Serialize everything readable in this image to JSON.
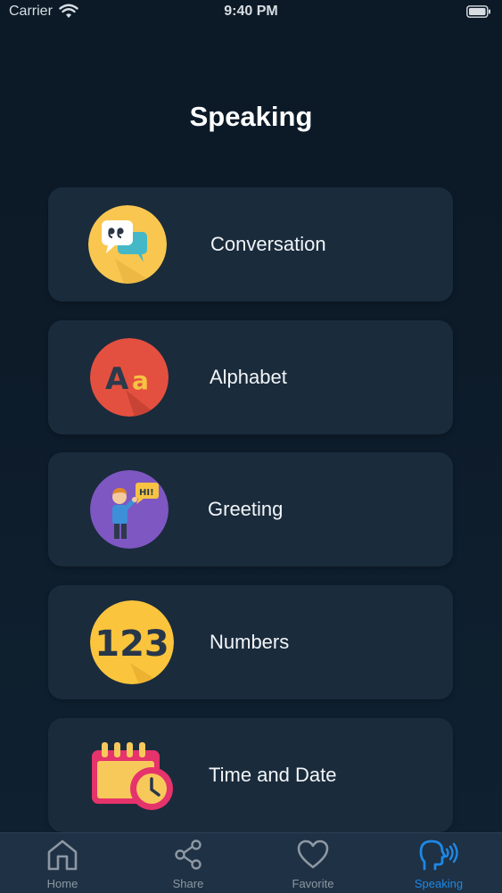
{
  "status_bar": {
    "carrier": "Carrier",
    "time": "9:40 PM"
  },
  "title": "Speaking",
  "categories": [
    {
      "label": "Conversation",
      "icon": "speech-bubbles-icon",
      "color": "#f9c74f"
    },
    {
      "label": "Alphabet",
      "icon": "letters-aa-icon",
      "color": "#e4503f"
    },
    {
      "label": "Greeting",
      "icon": "person-hi-icon",
      "color": "#7e57c2"
    },
    {
      "label": "Numbers",
      "icon": "numbers-123-icon",
      "color": "#fbc43d"
    },
    {
      "label": "Time and Date",
      "icon": "calendar-clock-icon",
      "color": "#e5336b"
    }
  ],
  "tab_bar": {
    "items": [
      {
        "label": "Home",
        "icon": "home-icon"
      },
      {
        "label": "Share",
        "icon": "share-icon"
      },
      {
        "label": "Favorite",
        "icon": "heart-icon"
      },
      {
        "label": "Speaking",
        "icon": "speaking-head-icon"
      }
    ],
    "active": "Speaking",
    "active_color": "#1e88e5",
    "inactive_color": "#8d98a3"
  }
}
